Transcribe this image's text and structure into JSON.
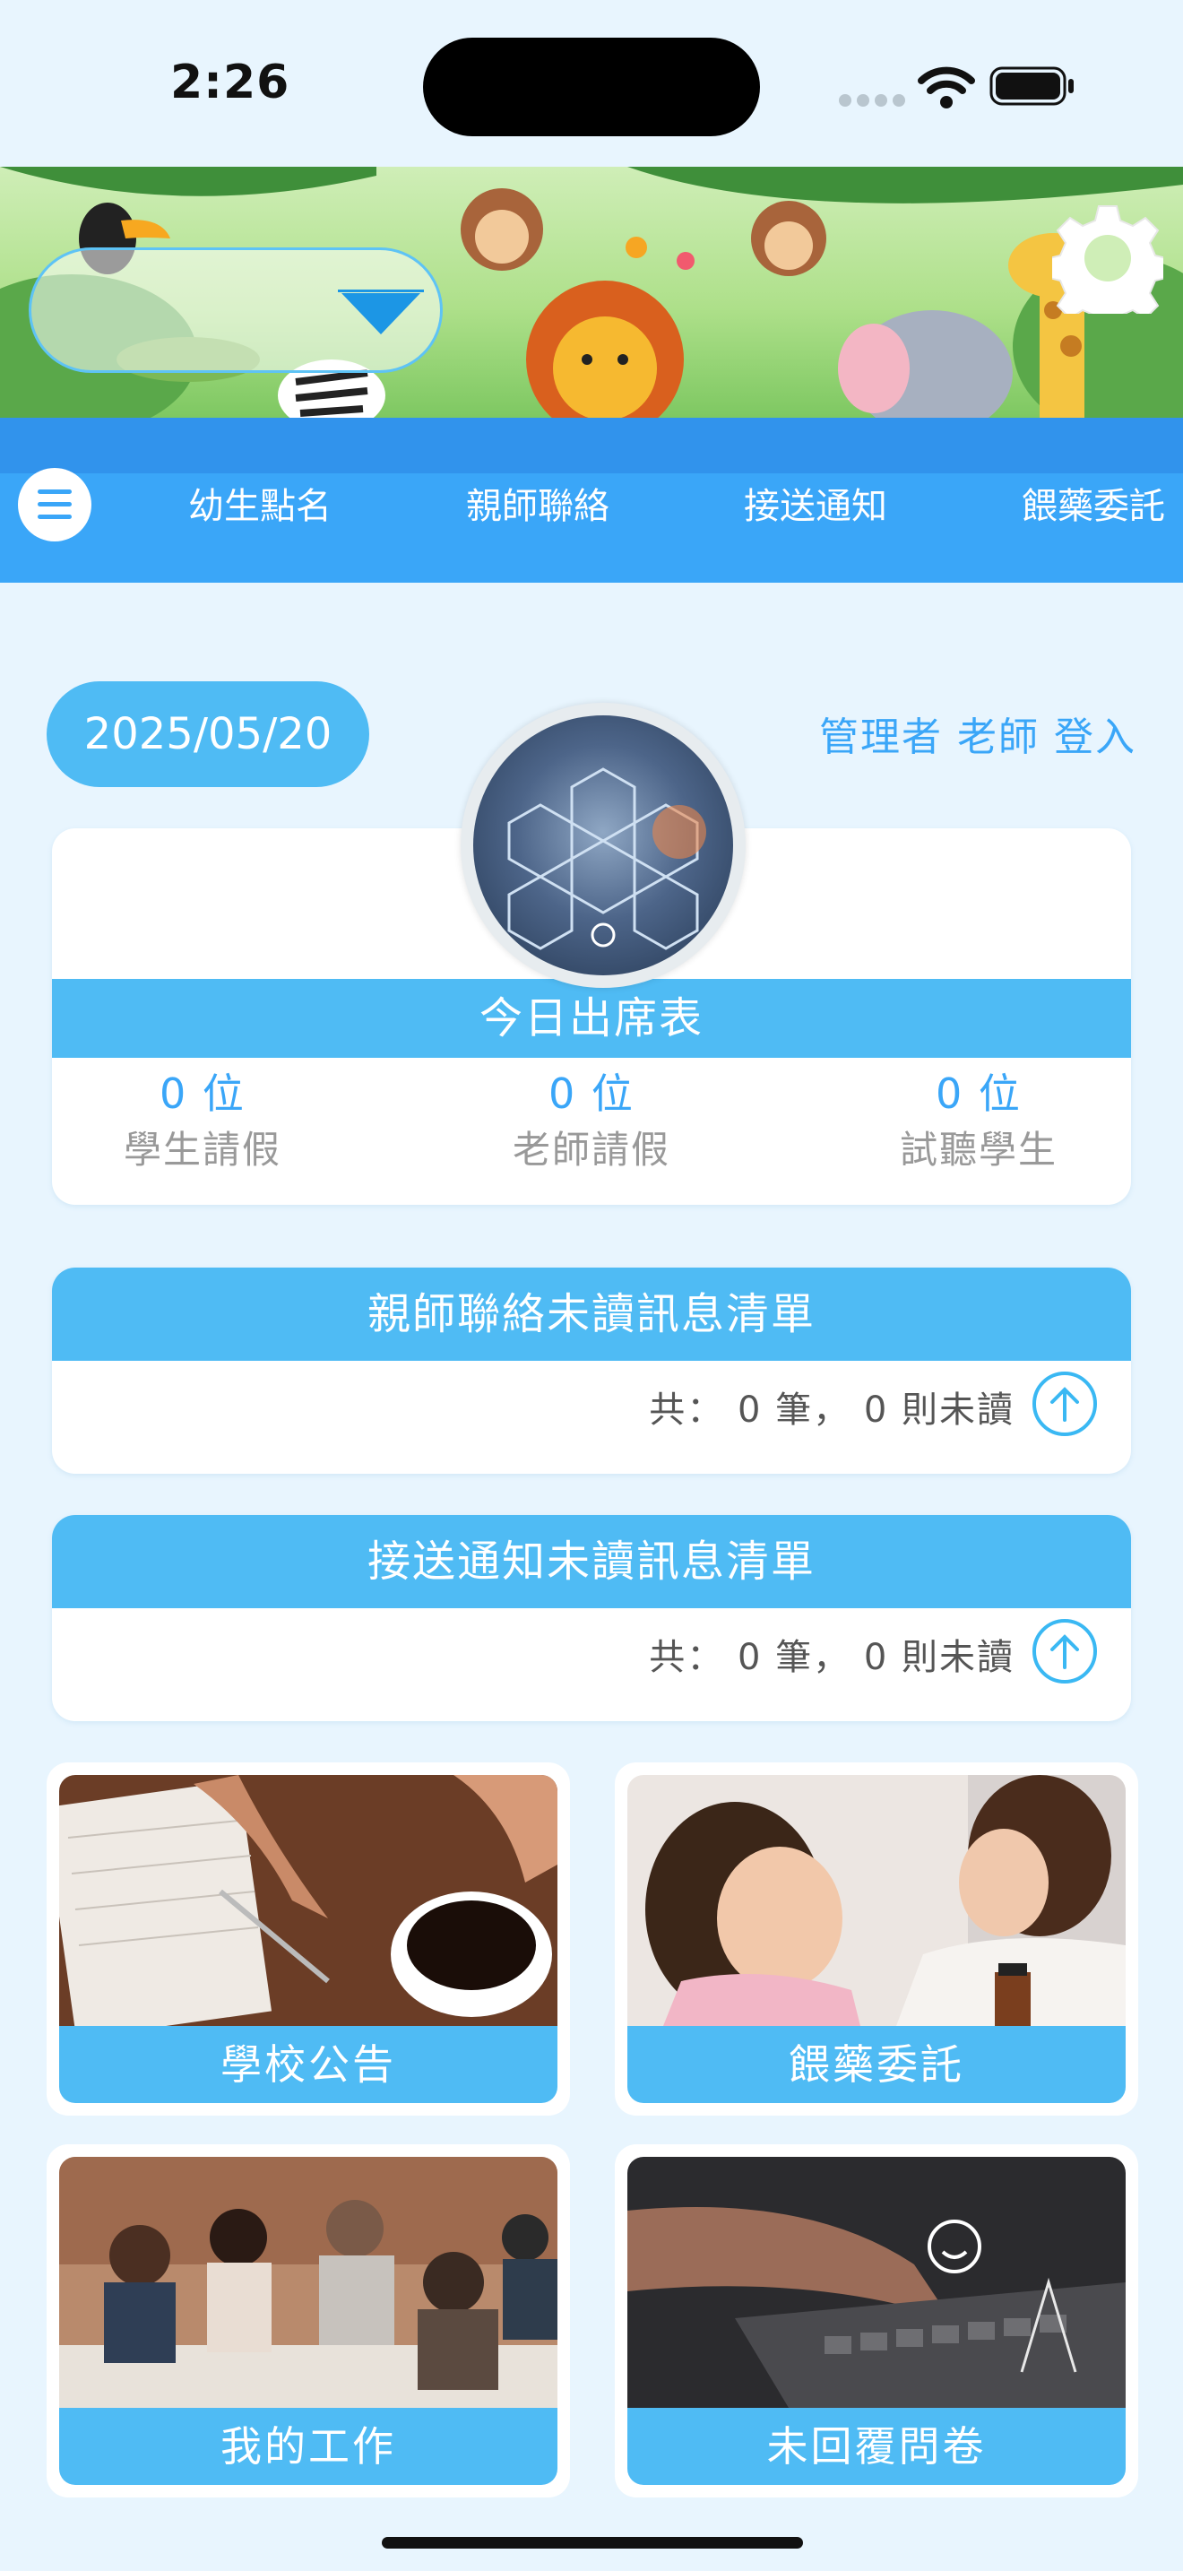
{
  "status_bar": {
    "time": "2:26"
  },
  "nav": {
    "items": [
      {
        "label": "幼生點名"
      },
      {
        "label": "親師聯絡"
      },
      {
        "label": "接送通知"
      },
      {
        "label": "餵藥委託"
      }
    ]
  },
  "header": {
    "date": "2025/05/20",
    "login_text": "管理者 老師 登入"
  },
  "attendance": {
    "title": "今日出席表",
    "stats": [
      {
        "value": "0 位",
        "label": "學生請假"
      },
      {
        "value": "0 位",
        "label": "老師請假"
      },
      {
        "value": "0 位",
        "label": "試聽學生"
      }
    ]
  },
  "parent_teacher_unread": {
    "title": "親師聯絡未讀訊息清單",
    "summary": "共： 0 筆， 0 則未讀"
  },
  "pickup_unread": {
    "title": "接送通知未讀訊息清單",
    "summary": "共： 0 筆， 0 則未讀"
  },
  "tiles": [
    {
      "label": "學校公告"
    },
    {
      "label": "餵藥委託"
    },
    {
      "label": "我的工作"
    },
    {
      "label": "未回覆問卷"
    }
  ],
  "colors": {
    "accent": "#4fbbf4",
    "nav": "#3aa6f8",
    "background": "#e8f5fe"
  }
}
